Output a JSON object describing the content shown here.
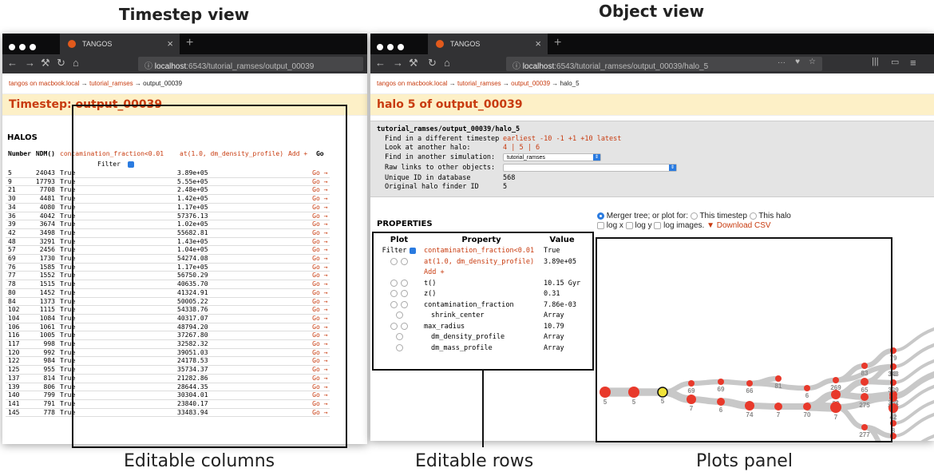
{
  "captions": {
    "timestep_title": "Timestep view",
    "object_title": "Object view",
    "editable_columns": "Editable columns",
    "editable_rows": "Editable rows",
    "plots_panel": "Plots panel"
  },
  "colors": {
    "accent": "#c83b0f",
    "title_bg": "#fdf0c7",
    "node": "#e8392b",
    "current_node": "#f1e33a",
    "branch": "#c8c8c8"
  },
  "left_window": {
    "tab_label": "TANGOS",
    "url_host": "localhost",
    "url_rest": ":6543/tutorial_ramses/output_00039",
    "breadcrumb": {
      "root": "tangos on macbook.local",
      "arrow": "→",
      "sim": "tutorial_ramses",
      "current": "output_00039"
    },
    "page_title": "Timestep: output_00039",
    "section_heading": "HALOS",
    "columns": [
      "Number",
      "NDM()",
      "contamination_fraction<0.01",
      "at(1.0, dm_density_profile)",
      "Add +",
      "Go"
    ],
    "filter_label": "Filter",
    "go_label": "Go →",
    "rows": [
      [
        "5",
        "24043",
        "True",
        "3.89e+05"
      ],
      [
        "9",
        "17793",
        "True",
        "5.55e+05"
      ],
      [
        "21",
        "7708",
        "True",
        "2.48e+05"
      ],
      [
        "30",
        "4481",
        "True",
        "1.42e+05"
      ],
      [
        "34",
        "4080",
        "True",
        "1.17e+05"
      ],
      [
        "36",
        "4042",
        "True",
        "57376.13"
      ],
      [
        "39",
        "3674",
        "True",
        "1.02e+05"
      ],
      [
        "42",
        "3498",
        "True",
        "55682.81"
      ],
      [
        "48",
        "3291",
        "True",
        "1.43e+05"
      ],
      [
        "57",
        "2456",
        "True",
        "1.04e+05"
      ],
      [
        "69",
        "1730",
        "True",
        "54274.08"
      ],
      [
        "76",
        "1585",
        "True",
        "1.17e+05"
      ],
      [
        "77",
        "1552",
        "True",
        "56750.29"
      ],
      [
        "78",
        "1515",
        "True",
        "40635.70"
      ],
      [
        "80",
        "1452",
        "True",
        "41324.91"
      ],
      [
        "84",
        "1373",
        "True",
        "50005.22"
      ],
      [
        "102",
        "1115",
        "True",
        "54338.76"
      ],
      [
        "104",
        "1084",
        "True",
        "40317.07"
      ],
      [
        "106",
        "1061",
        "True",
        "48794.20"
      ],
      [
        "116",
        "1005",
        "True",
        "37267.80"
      ],
      [
        "117",
        "998",
        "True",
        "32582.32"
      ],
      [
        "120",
        "992",
        "True",
        "39051.03"
      ],
      [
        "122",
        "984",
        "True",
        "24178.53"
      ],
      [
        "125",
        "955",
        "True",
        "35734.37"
      ],
      [
        "137",
        "814",
        "True",
        "21282.86"
      ],
      [
        "139",
        "806",
        "True",
        "28644.35"
      ],
      [
        "140",
        "799",
        "True",
        "30304.01"
      ],
      [
        "141",
        "791",
        "True",
        "23840.17"
      ],
      [
        "145",
        "778",
        "True",
        "33483.94"
      ]
    ]
  },
  "right_window": {
    "tab_label": "TANGOS",
    "url_host": "localhost",
    "url_rest": ":6543/tutorial_ramses/output_00039/halo_5",
    "url_actions": "···",
    "breadcrumb": {
      "root": "tangos on macbook.local",
      "arrow": "→",
      "sim": "tutorial_ramses",
      "step": "output_00039",
      "current": "halo_5"
    },
    "page_title": "halo 5 of output_00039",
    "info_heading": "tutorial_ramses/output_00039/halo_5",
    "info": {
      "find_timestep_label": "Find in a different timestep",
      "find_timestep_links": "earliest -10 -1 +1 +10 latest",
      "look_label": "Look at another halo:",
      "look_links": "4 | 5 | 6",
      "find_sim_label": "Find in another simulation:",
      "find_sim_value": "tutorial_ramses",
      "raw_label": "Raw links to other objects:",
      "raw_value": "",
      "unique_label": "Unique ID in database",
      "unique_value": "568",
      "finder_label": "Original halo finder ID",
      "finder_value": "5"
    },
    "properties_heading": "PROPERTIES",
    "prop_headers": [
      "Plot",
      "Property",
      "Value"
    ],
    "filter_label": "Filter",
    "properties": [
      {
        "name": "contamination_fraction<0.01",
        "value": "True",
        "radios": 0,
        "filter": true,
        "link": true
      },
      {
        "name": "at(1.0, dm_density_profile)",
        "value": "3.89e+05",
        "radios": 2,
        "filter": false,
        "link": true
      },
      {
        "name": "Add +",
        "value": "",
        "radios": 0,
        "filter": false,
        "link": true
      },
      {
        "name": "t()",
        "value": "10.15 Gyr",
        "radios": 2,
        "filter": false,
        "link": false
      },
      {
        "name": "z()",
        "value": "0.31",
        "radios": 2,
        "filter": false,
        "link": false
      },
      {
        "name": "contamination_fraction",
        "value": "7.86e-03",
        "radios": 2,
        "filter": false,
        "link": false
      },
      {
        "name": "shrink_center",
        "value": "Array",
        "radios": 1,
        "filter": false,
        "link": false
      },
      {
        "name": "max_radius",
        "value": "10.79",
        "radios": 2,
        "filter": false,
        "link": false
      },
      {
        "name": "dm_density_profile",
        "value": "Array",
        "radios": 1,
        "filter": false,
        "link": false
      },
      {
        "name": "dm_mass_profile",
        "value": "Array",
        "radios": 1,
        "filter": false,
        "link": false
      }
    ],
    "plot_controls": {
      "merger_label": "Merger tree; or plot for:",
      "this_timestep": "This timestep",
      "this_halo": "This halo",
      "log_x": "log x",
      "log_y": "log y",
      "log_images": "log images.",
      "download": "▼ Download CSV"
    },
    "merger_tree_labels": [
      "5",
      "5",
      "5",
      "7",
      "69",
      "6",
      "69",
      "74",
      "66",
      "7",
      "81",
      "70",
      "6",
      "82",
      "269",
      "7",
      "65",
      "275",
      "83",
      "79",
      "58",
      "352",
      "339",
      "343",
      "454",
      "277",
      "42",
      "8",
      "350",
      "275"
    ]
  }
}
